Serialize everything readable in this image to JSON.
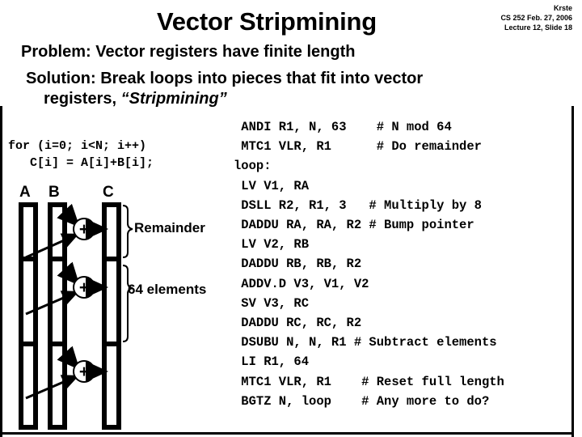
{
  "header": {
    "title": "Vector Stripmining",
    "author": "Krste",
    "course_date": "CS 252 Feb. 27, 2006",
    "lecture_slide": "Lecture 12, Slide 18"
  },
  "bullets": {
    "problem": "Problem: Vector registers have finite length",
    "solution_line1": "Solution: Break loops into pieces that fit into vector",
    "solution_line2_prefix": "registers, ",
    "solution_line2_emphasis": "“Stripmining”"
  },
  "code": {
    "c_source": "for (i=0; i<N; i++)\n   C[i] = A[i]+B[i];",
    "assembly": [
      " ANDI R1, N, 63    # N mod 64",
      " MTC1 VLR, R1      # Do remainder",
      "loop:",
      " LV V1, RA",
      " DSLL R2, R1, 3   # Multiply by 8",
      " DADDU RA, RA, R2 # Bump pointer",
      " LV V2, RB",
      " DADDU RB, RB, R2",
      " ADDV.D V3, V1, V2",
      " SV V3, RC",
      " DADDU RC, RC, R2",
      " DSUBU N, N, R1 # Subtract elements",
      " LI R1, 64",
      " MTC1 VLR, R1    # Reset full length",
      " BGTZ N, loop    # Any more to do?"
    ]
  },
  "diagram": {
    "column_labels": [
      "A",
      "B",
      "C"
    ],
    "operator_symbol": "+",
    "brace_labels": [
      "Remainder",
      "64 elements"
    ],
    "segment_count": 3,
    "colors": {
      "ink": "#000000",
      "paper": "#ffffff"
    }
  }
}
